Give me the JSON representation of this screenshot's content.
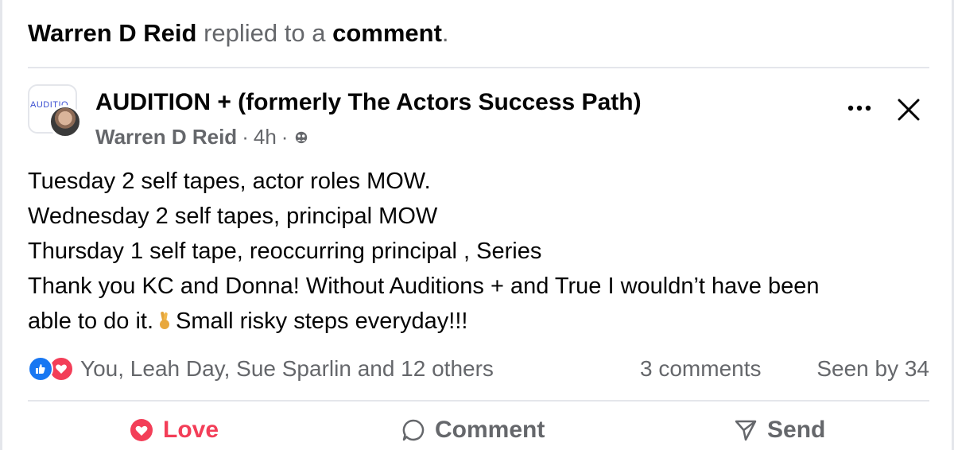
{
  "activity": {
    "actor": "Warren D Reid",
    "verb": "replied to a",
    "object": "comment",
    "period": "."
  },
  "post": {
    "group_logo_text": "AUDITIO",
    "group_name": "AUDITION + (formerly The Actors Success Path)",
    "author": "Warren D Reid",
    "separator": "·",
    "time": "4h",
    "privacy_icon": "group-privacy-icon",
    "lines": [
      "Tuesday 2 self tapes, actor roles MOW.",
      "Wednesday 2 self tapes, principal MOW",
      "Thursday 1 self tape, reoccurring principal , Series",
      "Thank you KC and Donna! Without Auditions + and True I wouldn’t have been",
      "able to do it.",
      "Small risky steps everyday!!!"
    ],
    "emoji": "crossed-fingers-emoji"
  },
  "stats": {
    "reactions": [
      "like",
      "love"
    ],
    "reactors_text": "You, Leah Day, Sue Sparlin and 12 others",
    "comments_text": "3 comments",
    "seen_text": "Seen by 34"
  },
  "actions": {
    "love_label": "Love",
    "comment_label": "Comment",
    "send_label": "Send"
  },
  "colors": {
    "love_red": "#f33e58",
    "like_blue": "#1877f2",
    "muted_gray": "#65676b",
    "divider": "#e4e6eb"
  }
}
